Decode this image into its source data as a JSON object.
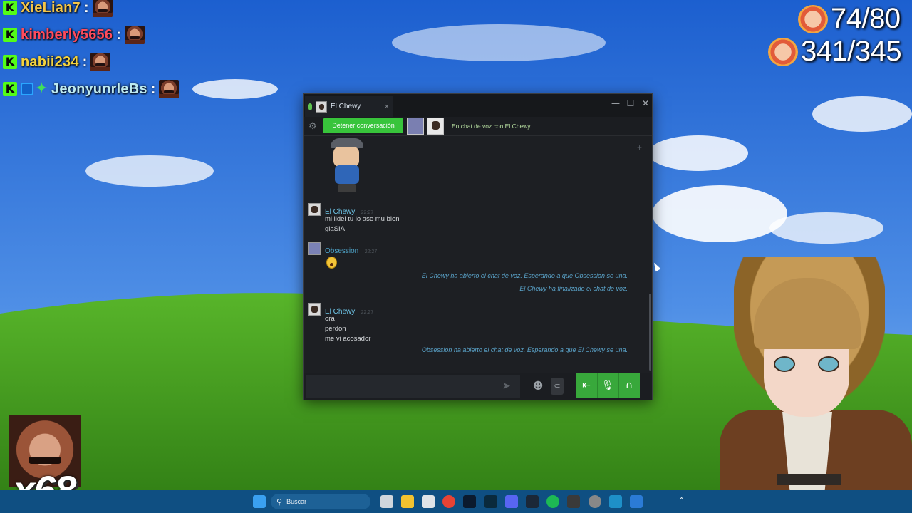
{
  "overlay_chat": [
    {
      "badges": [
        "k"
      ],
      "user": "XieLian7",
      "color": "#f2c54a",
      "separator": ":"
    },
    {
      "badges": [
        "k"
      ],
      "user": "kimberly5656",
      "color": "#ff4b5c",
      "separator": ":"
    },
    {
      "badges": [
        "k"
      ],
      "user": "nabii234",
      "color": "#f3d23e",
      "separator": ":"
    },
    {
      "badges": [
        "k",
        "blue",
        "green-star"
      ],
      "user": "JeonyunrleBs",
      "color": "#bdeaf1",
      "separator": ":"
    }
  ],
  "counters": [
    {
      "value": "74/80"
    },
    {
      "value": "341/345"
    }
  ],
  "combo": "x68",
  "chat_window": {
    "tab_title": "El Chewy",
    "tab_close": "×",
    "controls": {
      "minimize": "—",
      "maximize": "☐",
      "close": "✕"
    },
    "voice_bar": {
      "stop_button": "Detener conversación",
      "status": "En chat de voz con El Chewy"
    },
    "messages": [
      {
        "author": "El Chewy",
        "time": "22:27",
        "lines": [
          "mi lidel tu lo ase mu bien",
          "glaSIA"
        ]
      },
      {
        "author": "Obsession",
        "time": "22:27",
        "lines": []
      },
      {
        "author": "El Chewy",
        "time": "22:27",
        "lines": [
          "ora",
          "perdon",
          "me vi acosador"
        ]
      }
    ],
    "system_messages": [
      "El Chewy ha abierto el chat de voz. Esperando a que Obsession se una.",
      "El Chewy ha finalizado el chat de voz.",
      "Obsession ha abierto el chat de voz. Esperando a que El Chewy se una."
    ],
    "input": {
      "value": "",
      "placeholder": ""
    }
  },
  "taskbar": {
    "search_label": "Buscar"
  },
  "colors": {
    "accent_green": "#38c43b",
    "name_blue": "#6fc6e8",
    "system_text": "#5aa3c9",
    "taskbar": "#0f4f82"
  }
}
